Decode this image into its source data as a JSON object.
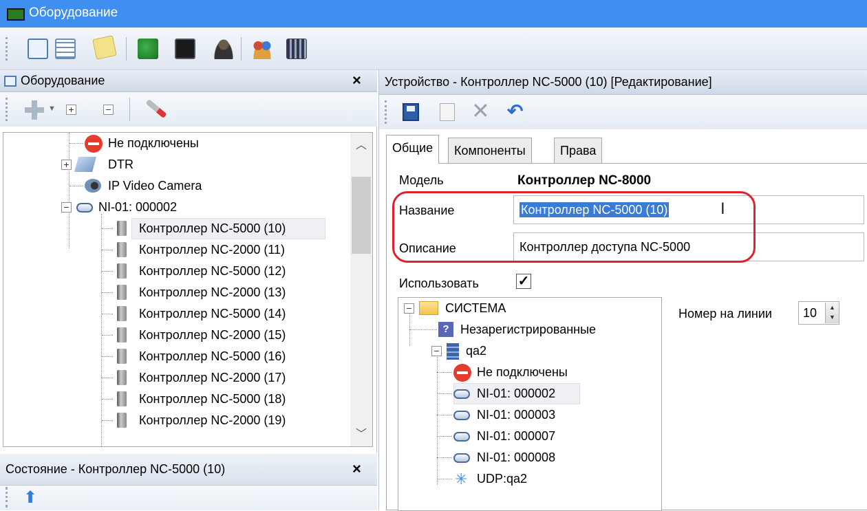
{
  "window": {
    "title": "Оборудование"
  },
  "left_panel": {
    "title": "Оборудование",
    "tree": [
      {
        "label": "Не подключены"
      },
      {
        "label": "DTR"
      },
      {
        "label": "IP Video Camera"
      },
      {
        "label": "NI-01: 000002"
      },
      {
        "label": "Контроллер NC-5000 (10)"
      },
      {
        "label": "Контроллер NC-2000 (11)"
      },
      {
        "label": "Контроллер NC-5000 (12)"
      },
      {
        "label": "Контроллер NC-2000 (13)"
      },
      {
        "label": "Контроллер NC-5000 (14)"
      },
      {
        "label": "Контроллер NC-2000 (15)"
      },
      {
        "label": "Контроллер NC-5000 (16)"
      },
      {
        "label": "Контроллер NC-2000 (17)"
      },
      {
        "label": "Контроллер NC-5000 (18)"
      },
      {
        "label": "Контроллер NC-2000 (19)"
      }
    ],
    "expander_plus": "+",
    "expander_minus": "−"
  },
  "status_panel": {
    "title": "Состояние - Контроллер NC-5000 (10)"
  },
  "right_panel": {
    "title": "Устройство - Контроллер NC-5000 (10) [Редактирование]",
    "tabs": [
      "Общие",
      "Компоненты",
      "Права"
    ],
    "model_label": "Модель",
    "model_value": "Контроллер NC-8000",
    "name_label": "Название",
    "name_value": "Контроллер NC-5000 (10)",
    "desc_label": "Описание",
    "desc_value": "Контроллер доступа NC-5000",
    "use_label": "Использовать",
    "use_checked": true,
    "line_number_label": "Номер на линии",
    "line_number_value": "10",
    "tree": [
      {
        "label": "СИСТЕМА"
      },
      {
        "label": "Незарегистрированные"
      },
      {
        "label": "qa2"
      },
      {
        "label": "Не подключены"
      },
      {
        "label": "NI-01: 000002"
      },
      {
        "label": "NI-01: 000003"
      },
      {
        "label": "NI-01: 000007"
      },
      {
        "label": "NI-01: 000008"
      },
      {
        "label": "UDP:qa2"
      }
    ]
  },
  "colors": {
    "title_bar": "#3f8ff0",
    "highlight_ring": "#e0202a",
    "selection": "#3a7bd5"
  }
}
